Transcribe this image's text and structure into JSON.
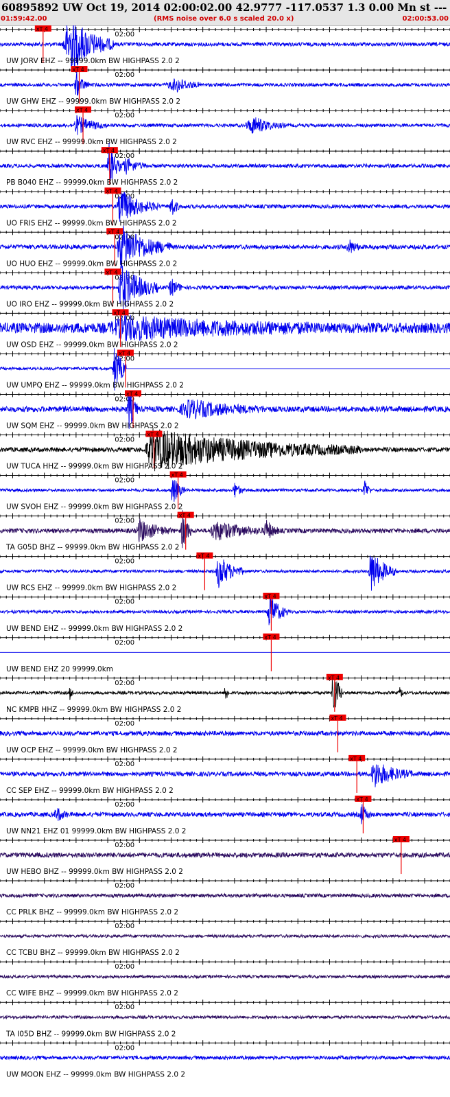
{
  "header": {
    "title": "60895892 UW Oct 19, 2014 02:00:02.00   42.9777 -117.0537  1.3 0.00 Mn st --- -- --  -1",
    "start_time": "01:59:42.00",
    "note": "(RMS noise over 6.0 s scaled 20.0 x)",
    "end_time": "02:00:53.00"
  },
  "colors": {
    "blue": "#0000ee",
    "black": "#000000",
    "purple": "#2a0a5e",
    "pick": "#ee0000",
    "background": "#ffffff"
  },
  "pick_label": "xT 4",
  "minute_label": "02:00",
  "traces": [
    {
      "label": "UW JORV EHZ -- 99999.0km BW  HIGHPASS  2.0  2",
      "color": "blue",
      "pick_time": 5.5,
      "noise": 0.1,
      "bursts": [
        [
          11,
          7,
          1.6,
          1.2
        ]
      ]
    },
    {
      "label": "UW GHW EHZ -- 99999.0km BW  HIGHPASS  2.0  2",
      "color": "blue",
      "pick_time": 11.2,
      "noise": 0.09,
      "bursts": [
        [
          12,
          2,
          0.7,
          0.3
        ],
        [
          28,
          4,
          0.35,
          2
        ]
      ]
    },
    {
      "label": "UW RVC EHZ -- 99999.0km BW  HIGHPASS  2.0  2",
      "color": "blue",
      "pick_time": 11.8,
      "noise": 0.09,
      "bursts": [
        [
          12,
          5,
          0.5,
          0.4
        ],
        [
          40,
          5,
          0.45,
          1.5
        ]
      ]
    },
    {
      "label": "PB B040 EHZ -- 99999.0km BW  HIGHPASS  2.0  2",
      "color": "blue",
      "pick_time": 16.0,
      "noise": 0.1,
      "bursts": [
        [
          17.2,
          2,
          1.2,
          0.3
        ],
        [
          20,
          3,
          0.4,
          1
        ]
      ]
    },
    {
      "label": "UO FRIS EHZ -- 99999.0km BW  HIGHPASS  2.0  2",
      "color": "blue",
      "pick_time": 16.5,
      "noise": 0.1,
      "bursts": [
        [
          19,
          6,
          0.9,
          0.6
        ],
        [
          27,
          1.5,
          0.6,
          0.3
        ]
      ]
    },
    {
      "label": "UO HUO EHZ -- 99999.0km BW  HIGHPASS  2.0  2",
      "color": "blue",
      "pick_time": 16.8,
      "noise": 0.12,
      "bursts": [
        [
          19,
          8,
          1.2,
          0.6
        ],
        [
          55,
          2,
          0.4,
          0.3
        ]
      ]
    },
    {
      "label": "UO IRO EHZ -- 99999.0km BW  HIGHPASS  2.0  2",
      "color": "blue",
      "pick_time": 16.5,
      "noise": 0.1,
      "bursts": [
        [
          19,
          6,
          1.4,
          0.4
        ],
        [
          27,
          2,
          0.5,
          0.4
        ]
      ]
    },
    {
      "label": "UW OSD EHZ -- 99999.0km BW  HIGHPASS  2.0  2",
      "color": "blue",
      "pick_time": 17.7,
      "noise": 0.28,
      "bursts": [
        [
          20,
          30,
          0.5,
          3
        ]
      ]
    },
    {
      "label": "UW UMPQ EHZ -- 99999.0km BW  HIGHPASS  2.0  2",
      "color": "blue",
      "pick_time": 18.5,
      "noise": 0.08,
      "bursts": [
        [
          18,
          2.5,
          1.3,
          0.2
        ]
      ],
      "flat_after": 19.9
    },
    {
      "label": "UW SQM EHZ -- 99999.0km BW  HIGHPASS  2.0  2",
      "color": "blue",
      "pick_time": 19.7,
      "noise": 0.15,
      "bursts": [
        [
          20.3,
          1.5,
          1.2,
          0.3
        ],
        [
          30,
          12,
          0.45,
          2
        ]
      ]
    },
    {
      "label": "UW TUCA HHZ -- 99999.0km BW  HIGHPASS  2.0  2",
      "color": "black",
      "pick_time": 23.0,
      "noise": 0.12,
      "bursts": [
        [
          24,
          33,
          1.1,
          1.2
        ]
      ]
    },
    {
      "label": "UW SVOH EHZ -- 99999.0km BW  HIGHPASS  2.0  2",
      "color": "blue",
      "pick_time": 26.8,
      "noise": 0.08,
      "bursts": [
        [
          27.2,
          2,
          0.8,
          0.3
        ],
        [
          37,
          1.5,
          0.45,
          0.3
        ],
        [
          57.5,
          1,
          0.7,
          0.2
        ]
      ]
    },
    {
      "label": "TA G05D BHZ -- 99999.0km BW  HIGHPASS  2.0  2",
      "color": "purple",
      "pick_time": 28.0,
      "noise": 0.12,
      "bursts": [
        [
          28.8,
          1.5,
          1.1,
          0.3
        ],
        [
          22,
          5,
          0.6,
          0.5
        ],
        [
          34,
          8,
          0.5,
          1
        ],
        [
          42,
          2,
          0.6,
          0.3
        ]
      ]
    },
    {
      "label": "UW RCS EHZ -- 99999.0km BW  HIGHPASS  2.0  2",
      "color": "blue",
      "pick_time": 31.0,
      "noise": 0.08,
      "bursts": [
        [
          34.5,
          4,
          0.9,
          0.5
        ],
        [
          58.5,
          4,
          1.2,
          0.4
        ]
      ]
    },
    {
      "label": "UW BEND EHZ -- 99999.0km BW  HIGHPASS  2.0  2",
      "color": "blue",
      "pick_time": 41.5,
      "noise": 0.08,
      "bursts": [
        [
          42.5,
          3,
          1.0,
          0.4
        ]
      ]
    },
    {
      "label": "UW BEND EHZ 20 99999.0km",
      "color": "blue",
      "pick_time": 41.5,
      "noise": 0.0,
      "bursts": [],
      "flat": true
    },
    {
      "label": "NC KMPB HHZ -- 99999.0km BW  HIGHPASS  2.0  2",
      "color": "black",
      "pick_time": 51.5,
      "noise": 0.08,
      "bursts": [
        [
          52.5,
          1.5,
          1.8,
          0.15
        ],
        [
          35.5,
          0.8,
          0.6,
          0.1
        ],
        [
          11,
          0.6,
          0.4,
          0.1
        ],
        [
          63,
          1,
          0.3,
          0.1
        ]
      ]
    },
    {
      "label": "UW OCP EHZ -- 99999.0km BW  HIGHPASS  2.0  2",
      "color": "blue",
      "pick_time": 52.0,
      "noise": 0.12,
      "bursts": []
    },
    {
      "label": "CC SEP EHZ -- 99999.0km BW  HIGHPASS  2.0  2",
      "color": "blue",
      "pick_time": 55.0,
      "noise": 0.12,
      "bursts": [
        [
          59,
          6,
          0.7,
          0.6
        ]
      ]
    },
    {
      "label": "UW NN21 EHZ 01 99999.0km BW  HIGHPASS  2.0  2",
      "color": "blue",
      "pick_time": 56.0,
      "noise": 0.12,
      "bursts": [
        [
          57,
          1.5,
          0.6,
          0.2
        ],
        [
          9,
          2,
          0.35,
          0.5
        ]
      ]
    },
    {
      "label": "UW HEBO BHZ -- 99999.0km BW  HIGHPASS  2.0  2",
      "color": "purple",
      "pick_time": 62.0,
      "noise": 0.13,
      "bursts": []
    },
    {
      "label": "CC PRLK BHZ -- 99999.0km BW  HIGHPASS  2.0  2",
      "color": "purple",
      "pick_time": null,
      "noise": 0.1,
      "bursts": []
    },
    {
      "label": "CC TCBU BHZ -- 99999.0km BW  HIGHPASS  2.0  2",
      "color": "purple",
      "pick_time": null,
      "noise": 0.08,
      "bursts": []
    },
    {
      "label": "CC WIFE BHZ -- 99999.0km BW  HIGHPASS  2.0  2",
      "color": "purple",
      "pick_time": null,
      "noise": 0.08,
      "bursts": []
    },
    {
      "label": "TA I05D BHZ -- 99999.0km BW  HIGHPASS  2.0  2",
      "color": "purple",
      "pick_time": null,
      "noise": 0.08,
      "bursts": []
    },
    {
      "label": "UW MOON EHZ -- 99999.0km BW  HIGHPASS  2.0  2",
      "color": "blue",
      "pick_time": null,
      "noise": 0.1,
      "bursts": []
    }
  ]
}
